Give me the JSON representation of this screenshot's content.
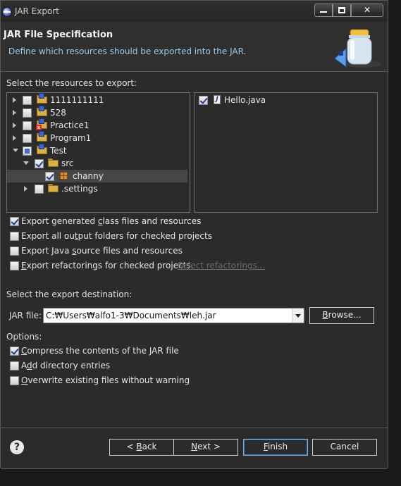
{
  "window": {
    "title": "JAR Export"
  },
  "header": {
    "title": "JAR File Specification",
    "description": "Define which resources should be exported into the JAR."
  },
  "resources": {
    "label": "Select the resources to export:",
    "tree": [
      {
        "label": "1111111111",
        "expanded": false,
        "checked": false
      },
      {
        "label": "528",
        "expanded": false,
        "checked": false
      },
      {
        "label": "Practice1",
        "expanded": false,
        "checked": false
      },
      {
        "label": "Program1",
        "expanded": false,
        "checked": false
      },
      {
        "label": "Test",
        "expanded": true,
        "checked": "partial"
      },
      {
        "label": "src",
        "expanded": true,
        "checked": true
      },
      {
        "label": "channy",
        "checked": true,
        "selected": true
      },
      {
        "label": ".settings",
        "expanded": false,
        "checked": false
      }
    ],
    "files": [
      {
        "label": "Hello.java",
        "checked": true
      }
    ]
  },
  "export_options": [
    {
      "pre": "Export generated ",
      "mnemonic": "c",
      "post": "lass files and resources",
      "checked": true
    },
    {
      "pre": "Export all ou",
      "mnemonic": "t",
      "post": "put folders for checked projects",
      "checked": false
    },
    {
      "pre": "Export Java ",
      "mnemonic": "s",
      "post": "ource files and resources",
      "checked": false
    },
    {
      "pre": "",
      "mnemonic": "E",
      "post": "xport refactorings for checked projects.",
      "checked": false
    }
  ],
  "select_refactorings": "Select refactorings...",
  "destination": {
    "label": "Select the export destination:",
    "jar_file_label": "JAR file:",
    "jar_file_value": "C:₩Users₩alfo1-3₩Documents₩leh.jar",
    "browse": {
      "pre": "",
      "mnemonic": "B",
      "post": "rowse..."
    }
  },
  "options": {
    "label": "Options:",
    "items": [
      {
        "pre": "",
        "mnemonic": "C",
        "post": "ompress the contents of the JAR file",
        "checked": true
      },
      {
        "pre": "A",
        "mnemonic": "d",
        "post": "d directory entries",
        "checked": false
      },
      {
        "pre": "",
        "mnemonic": "O",
        "post": "verwrite existing files without warning",
        "checked": false
      }
    ]
  },
  "buttons": {
    "back": {
      "pre": "< ",
      "mnemonic": "B",
      "post": "ack"
    },
    "next": {
      "pre": "",
      "mnemonic": "N",
      "post": "ext >"
    },
    "finish": {
      "pre": "",
      "mnemonic": "F",
      "post": "inish"
    },
    "cancel": "Cancel"
  },
  "colors": {
    "background": "#2b2b2b",
    "accent": "#7fb0e6",
    "description_text": "#9ec8e8"
  }
}
